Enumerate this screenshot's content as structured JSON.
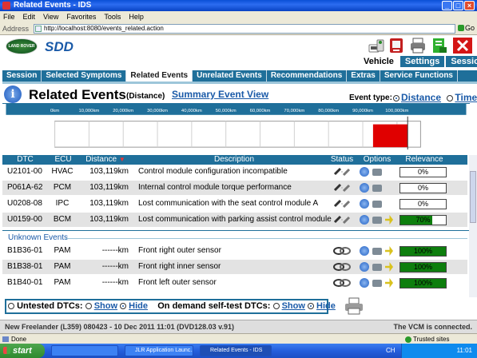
{
  "window": {
    "title": "Related Events - IDS"
  },
  "menu": [
    "File",
    "Edit",
    "View",
    "Favorites",
    "Tools",
    "Help"
  ],
  "address": {
    "label": "Address",
    "url": "http://localhost:8080/events_related.action",
    "go": "Go"
  },
  "header": {
    "logo_text": "LAND ROVER",
    "app_name": "SDD",
    "nav_tabs": [
      "Vehicle",
      "Settings",
      "Sessions"
    ],
    "nav_active": "Vehicle"
  },
  "tabs": [
    "Session",
    "Selected Symptoms",
    "Related Events",
    "Unrelated Events",
    "Recommendations",
    "Extras",
    "Service Functions"
  ],
  "active_tab": "Related Events",
  "page": {
    "title": "Related Events",
    "subtitle": "(Distance)",
    "summary_link": "Summary Event View",
    "event_type_label": "Event type:",
    "event_type_options": [
      "Distance",
      "Time"
    ],
    "event_type_selected": "Distance"
  },
  "chart_data": {
    "type": "bar",
    "x_axis_ticks": [
      "0km",
      "10,000km",
      "20,000km",
      "30,000km",
      "40,000km",
      "50,000km",
      "60,000km",
      "70,000km",
      "80,000km",
      "90,000km",
      "100,000km"
    ],
    "xlim": [
      0,
      100000
    ],
    "bars": [
      {
        "distance_km": 103119,
        "color": "#e00000"
      }
    ],
    "marker_km": 103119
  },
  "table": {
    "columns": [
      "DTC",
      "ECU",
      "Distance",
      "Description",
      "Status",
      "Options",
      "Relevance"
    ],
    "sort_column": "Distance",
    "rows": [
      {
        "dtc": "U2101-00",
        "ecu": "HVAC",
        "distance": "103,119km",
        "description": "Control module configuration incompatible",
        "options": [
          "info",
          "camera"
        ],
        "relevance": "0%",
        "relevance_value": 0
      },
      {
        "dtc": "P061A-62",
        "ecu": "PCM",
        "distance": "103,119km",
        "description": "Internal control module torque performance",
        "options": [
          "info",
          "camera"
        ],
        "relevance": "0%",
        "relevance_value": 0
      },
      {
        "dtc": "U0208-08",
        "ecu": "IPC",
        "distance": "103,119km",
        "description": "Lost communication with the seat control module A",
        "options": [
          "info",
          "camera"
        ],
        "relevance": "0%",
        "relevance_value": 0
      },
      {
        "dtc": "U0159-00",
        "ecu": "BCM",
        "distance": "103,119km",
        "description": "Lost communication with parking assist control module",
        "options": [
          "info",
          "camera",
          "arrow"
        ],
        "relevance": "70%",
        "relevance_value": 70
      }
    ],
    "unknown_label": "Unknown Events",
    "unknown_rows": [
      {
        "dtc": "B1B36-01",
        "ecu": "PAM",
        "distance": "------km",
        "description": "Front right outer sensor",
        "options": [
          "info",
          "camera",
          "arrow"
        ],
        "relevance": "100%",
        "relevance_value": 100
      },
      {
        "dtc": "B1B38-01",
        "ecu": "PAM",
        "distance": "------km",
        "description": "Front right inner sensor",
        "options": [
          "info",
          "camera",
          "arrow"
        ],
        "relevance": "100%",
        "relevance_value": 100
      },
      {
        "dtc": "B1B40-01",
        "ecu": "PAM",
        "distance": "------km",
        "description": "Front left outer sensor",
        "options": [
          "info",
          "camera",
          "arrow"
        ],
        "relevance": "100%",
        "relevance_value": 100
      }
    ]
  },
  "bottom": {
    "untested_label": "Untested DTCs:",
    "show": "Show",
    "hide": "Hide",
    "ondemand_label": "On demand self-test DTCs:",
    "untested_selected": "Hide",
    "ondemand_selected": "Hide"
  },
  "vehicle_status": {
    "vehicle": "New Freelander (L359) 080423 - 10 Dec 2011 11:01 (DVD128.03 v.91)",
    "vcm": "The VCM is connected."
  },
  "ie_status": {
    "left": "Done",
    "right": "Trusted sites"
  },
  "taskbar": {
    "start": "start",
    "items": [
      "",
      "JLR Application Launc...",
      "Related Events - IDS"
    ],
    "tray_lang": "CH",
    "clock": "11:01"
  },
  "colors": {
    "accent": "#1f6f9a",
    "link": "#1a5aa8",
    "relevance_fill": "#0d7e0d",
    "chart_bar": "#e00000"
  }
}
